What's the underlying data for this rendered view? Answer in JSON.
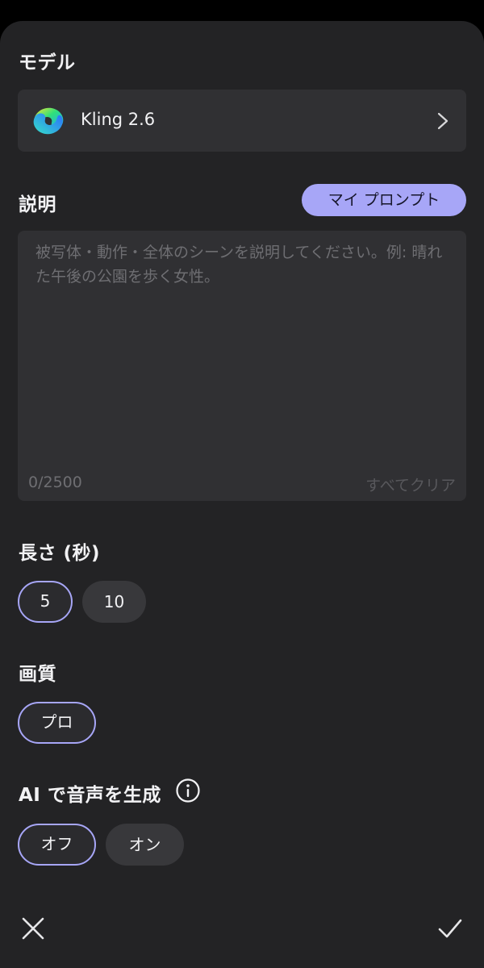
{
  "model_section": {
    "title": "モデル",
    "model_name": "Kling 2.6",
    "logo_icon": "kling-logo-icon",
    "chevron_icon": "chevron-right-icon"
  },
  "description_section": {
    "title": "説明",
    "my_prompt_button": "マイ プロンプト",
    "placeholder": "被写体・動作・全体のシーンを説明してください。例: 晴れた午後の公園を歩く女性。",
    "value": "",
    "char_count": "0/2500",
    "clear_all": "すべてクリア"
  },
  "duration_section": {
    "title": "長さ (秒)",
    "options": [
      "5",
      "10"
    ],
    "selected": "5"
  },
  "quality_section": {
    "title": "画質",
    "options": [
      "プロ"
    ],
    "selected": "プロ"
  },
  "audio_section": {
    "title": "AI で音声を生成",
    "info_icon": "info-icon",
    "options": [
      "オフ",
      "オン"
    ],
    "selected": "オフ"
  },
  "footer": {
    "close_icon": "close-icon",
    "confirm_icon": "checkmark-icon"
  },
  "colors": {
    "accent": "#a7a6f7",
    "sheet_background": "#232325",
    "card_background": "#303033"
  }
}
